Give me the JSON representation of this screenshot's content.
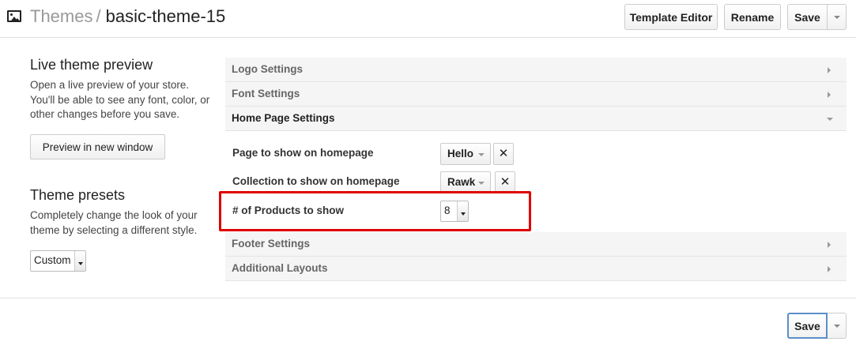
{
  "header": {
    "breadcrumb_root": "Themes",
    "separator": "/",
    "theme_name": "basic-theme-15",
    "template_editor_label": "Template Editor",
    "rename_label": "Rename",
    "save_label": "Save"
  },
  "preview": {
    "title": "Live theme preview",
    "description": "Open a live preview of your store. You'll be able to see any font, color, or other changes before you save.",
    "button_label": "Preview in new window"
  },
  "presets": {
    "title": "Theme presets",
    "description": "Completely change the look of your theme by selecting a different style.",
    "selected": "Custom"
  },
  "accordion": {
    "logo": "Logo Settings",
    "font": "Font Settings",
    "home": "Home Page Settings",
    "footer": "Footer Settings",
    "layouts": "Additional Layouts"
  },
  "home_settings": {
    "page_label": "Page to show on homepage",
    "page_value": "Hello",
    "collection_label": "Collection to show on homepage",
    "collection_value": "Rawk",
    "products_label": "# of Products to show",
    "products_value": "8",
    "remove_symbol": "✕"
  },
  "footer": {
    "save_label": "Save"
  },
  "colors": {
    "highlight": "#e00000",
    "focus_border": "#5b8fc7"
  }
}
